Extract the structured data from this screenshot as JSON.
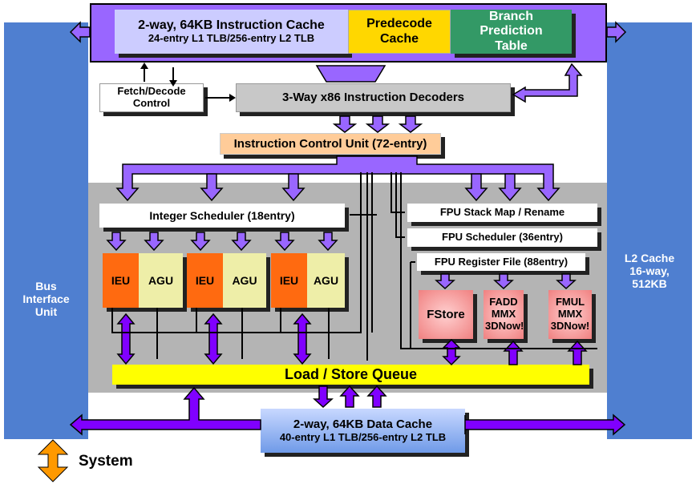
{
  "blocks": {
    "bus_interface": "Bus Interface Unit",
    "l2_cache": "L2 Cache 16-way, 512KB",
    "icache_line1": "2-way, 64KB Instruction Cache",
    "icache_line2": "24-entry L1 TLB/256-entry L2 TLB",
    "predecode": "Predecode Cache",
    "branch": "Branch Prediction Table",
    "fetch_decode": "Fetch/Decode Control",
    "decoders": "3-Way x86 Instruction Decoders",
    "icu": "Instruction Control Unit (72-entry)",
    "int_scheduler": "Integer Scheduler (18entry)",
    "ieu": "IEU",
    "agu": "AGU",
    "fpu_stack": "FPU Stack Map / Rename",
    "fpu_sched": "FPU Scheduler (36entry)",
    "fpu_regfile": "FPU Register File (88entry)",
    "fstore": "FStore",
    "fadd": "FADD MMX 3DNow!",
    "fmul": "FMUL MMX 3DNow!",
    "lsq": "Load / Store Queue",
    "dcache_line1": "2-way, 64KB Data Cache",
    "dcache_line2": "40-entry L1 TLB/256-entry L2 TLB",
    "system": "System"
  },
  "colors": {
    "purple": "#9966ff",
    "bus_blue": "#4f7fd0",
    "gray": "#b4b4b4",
    "yellow": "#ffff00",
    "orange": "#ff6a10",
    "green": "#339966"
  }
}
